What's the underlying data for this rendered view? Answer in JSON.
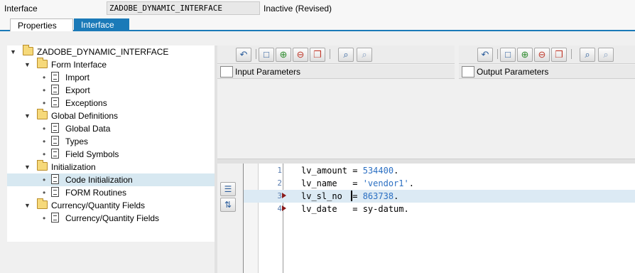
{
  "header": {
    "interface_label": "Interface",
    "interface_name": "ZADOBE_DYNAMIC_INTERFACE",
    "status": "Inactive (Revised)"
  },
  "tabs": [
    {
      "label": "Properties",
      "active": false
    },
    {
      "label": "Interface",
      "active": true
    }
  ],
  "tree": {
    "root": "ZADOBE_DYNAMIC_INTERFACE",
    "nodes": [
      {
        "label": "ZADOBE_DYNAMIC_INTERFACE",
        "level": 0,
        "kind": "folder"
      },
      {
        "label": "Form Interface",
        "level": 1,
        "kind": "folder"
      },
      {
        "label": "Import",
        "level": 2,
        "kind": "doc"
      },
      {
        "label": "Export",
        "level": 2,
        "kind": "doc"
      },
      {
        "label": "Exceptions",
        "level": 2,
        "kind": "doc"
      },
      {
        "label": "Global Definitions",
        "level": 1,
        "kind": "folder"
      },
      {
        "label": "Global Data",
        "level": 2,
        "kind": "doc"
      },
      {
        "label": "Types",
        "level": 2,
        "kind": "doc"
      },
      {
        "label": "Field Symbols",
        "level": 2,
        "kind": "doc"
      },
      {
        "label": "Initialization",
        "level": 1,
        "kind": "folder"
      },
      {
        "label": "Code Initialization",
        "level": 2,
        "kind": "doc",
        "selected": true
      },
      {
        "label": "FORM Routines",
        "level": 2,
        "kind": "doc"
      },
      {
        "label": "Currency/Quantity Fields",
        "level": 1,
        "kind": "folder"
      },
      {
        "label": "Currency/Quantity Fields",
        "level": 2,
        "kind": "doc"
      }
    ]
  },
  "panels": {
    "input_title": "Input Parameters",
    "output_title": "Output Parameters"
  },
  "code": {
    "lines": [
      {
        "no": "1",
        "var": "lv_amount",
        "pad": " = ",
        "value": "534400",
        "end": "."
      },
      {
        "no": "2",
        "var": "lv_name",
        "pad": "   = ",
        "value": "'vendor1'",
        "end": "."
      },
      {
        "no": "3",
        "var": "lv_sl_no",
        "pad": "  = ",
        "value": "863738",
        "end": "."
      },
      {
        "no": "4",
        "var": "lv_date",
        "pad": "   = ",
        "value": "sy-datum",
        "end": "."
      }
    ]
  },
  "colors": {
    "tab_active": "#1b7ab8",
    "selection": "#d7e8f1",
    "literal": "#2b6fc2"
  }
}
